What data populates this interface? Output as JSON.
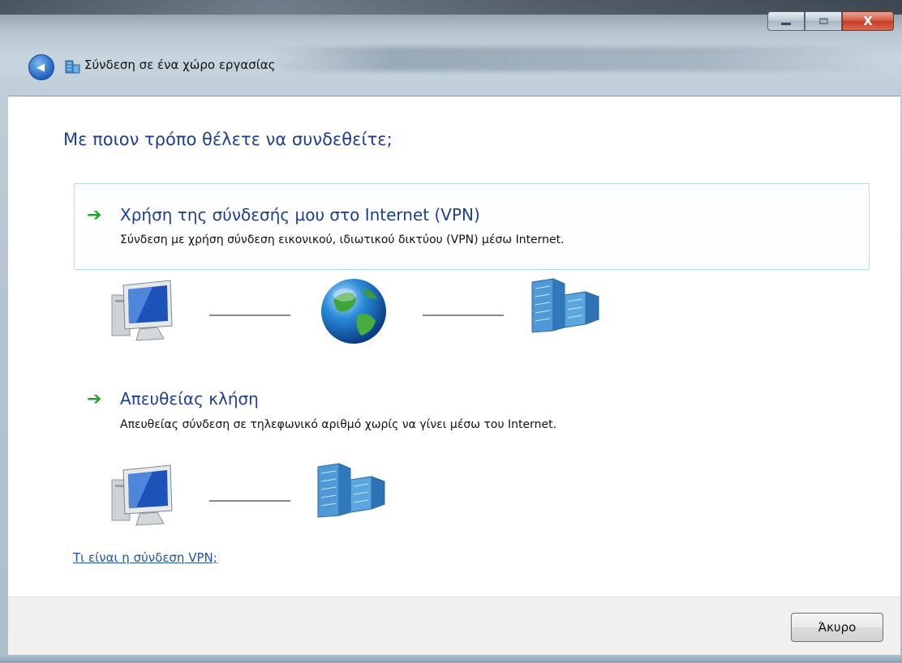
{
  "window": {
    "title": "Σύνδεση σε ένα χώρο εργασίας",
    "caption_buttons": {
      "close_glyph": "X"
    },
    "back_glyph": "◀"
  },
  "main": {
    "heading": "Με ποιον τρόπο θέλετε να συνδεθείτε;",
    "options": [
      {
        "title": "Χρήση της σύνδεσής μου στο Internet (VPN)",
        "description": "Σύνδεση με χρήση σύνδεση εικονικού, ιδιωτικού δικτύου (VPN) μέσω Internet.",
        "diagram_icons": [
          "computer-icon",
          "globe-icon",
          "office-building-icon"
        ]
      },
      {
        "title": "Απευθείας κλήση",
        "description": "Απευθείας σύνδεση σε τηλεφωνικό αριθμό χωρίς να γίνει μέσω του Internet.",
        "diagram_icons": [
          "computer-icon",
          "office-building-icon"
        ]
      }
    ],
    "help_link": "Τι είναι η σύνδεση VPN;",
    "arrow_glyph": "➔"
  },
  "footer": {
    "cancel_label": "Άκυρο"
  },
  "colors": {
    "heading": "#1e3f8f",
    "arrow": "#24a32e",
    "link": "#1e53b0",
    "option_border": "#b8dceb"
  }
}
